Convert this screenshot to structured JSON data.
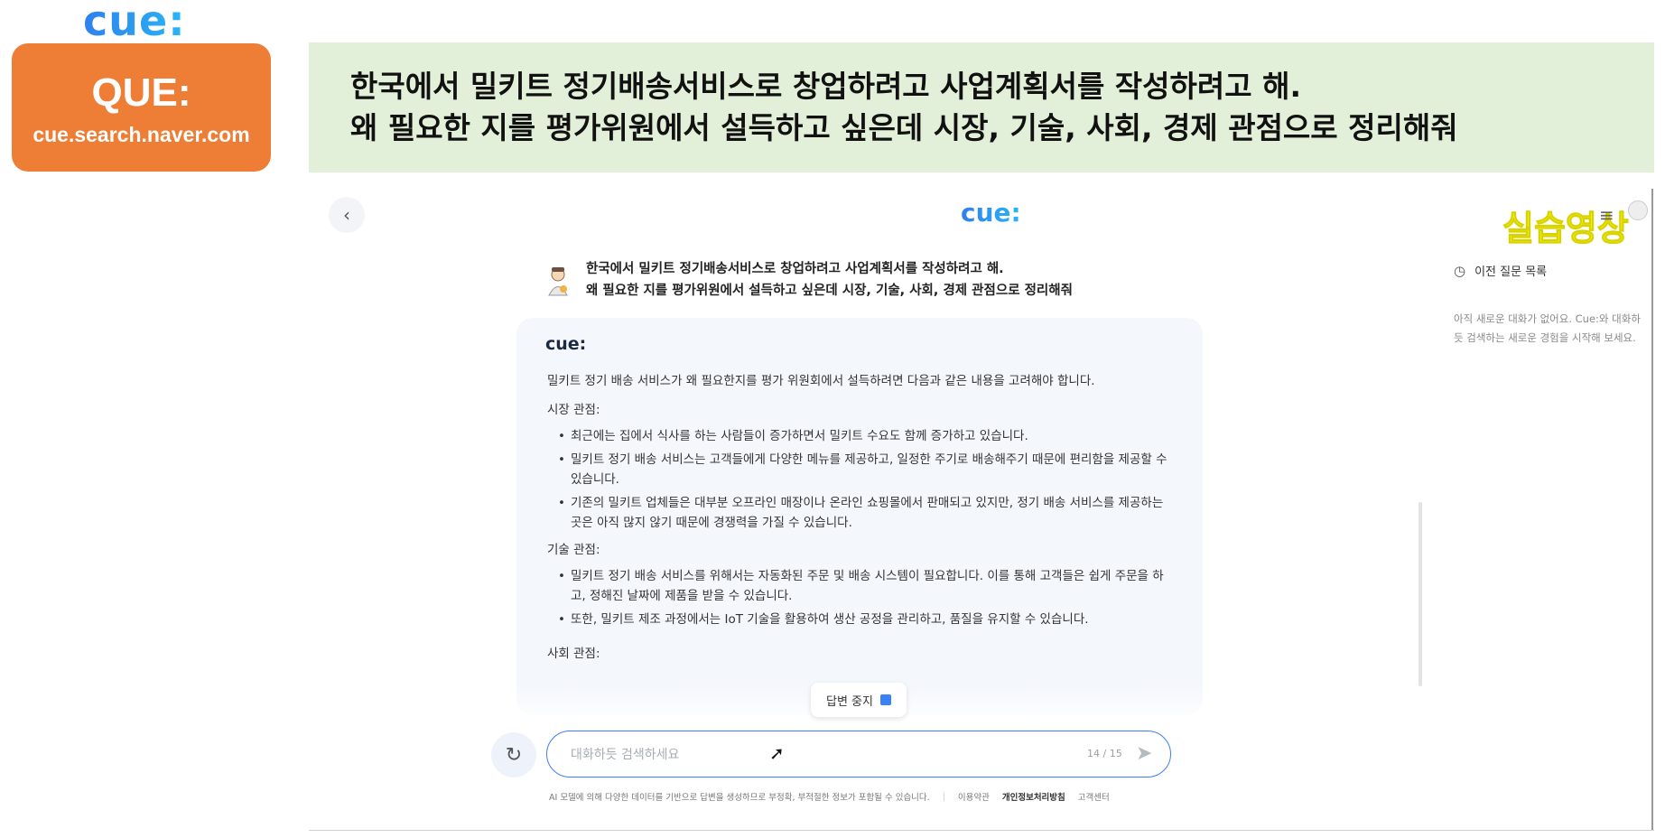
{
  "header": {
    "top_logo": "cue:",
    "badge_title": "QUE:",
    "badge_url": "cue.search.naver.com",
    "prompt_line1": "한국에서 밀키트 정기배송서비스로 창업하려고 사업계획서를 작성하려고 해.",
    "prompt_line2": "왜 필요한 지를 평가위원에서 설득하고 싶은데 시장, 기술, 사회, 경제 관점으로 정리해줘"
  },
  "app": {
    "logo": "cue:",
    "practice_label": "실습영상",
    "back_icon": "chevron-left-icon",
    "menu_icon": "hamburger-menu-icon"
  },
  "sidebar": {
    "history_label": "이전 질문 목록",
    "empty_text": "아직 새로운 대화가 없어요. Cue:와 대화하듯 검색하는 새로운 경험을 시작해 보세요."
  },
  "conversation": {
    "user_line1": "한국에서 밀키트 정기배송서비스로 창업하려고 사업계획서를 작성하려고 해.",
    "user_line2": "왜 필요한 지를 평가위원에서 설득하고 싶은데 시장, 기술, 사회, 경제 관점으로 정리해줘",
    "answer_logo": "cue:",
    "intro": "밀키트 정기 배송 서비스가 왜 필요한지를 평가 위원회에서 설득하려면 다음과 같은 내용을 고려해야 합니다.",
    "market_title": "시장 관점:",
    "market_items": [
      "최근에는 집에서 식사를 하는 사람들이 증가하면서 밀키트 수요도 함께 증가하고 있습니다.",
      "밀키트 정기 배송 서비스는 고객들에게 다양한 메뉴를 제공하고, 일정한 주기로 배송해주기 때문에 편리함을 제공할 수 있습니다.",
      "기존의 밀키트 업체들은 대부분 오프라인 매장이나 온라인 쇼핑몰에서 판매되고 있지만, 정기 배송 서비스를 제공하는 곳은 아직 많지 않기 때문에 경쟁력을 가질 수 있습니다."
    ],
    "tech_title": "기술 관점:",
    "tech_items": [
      "밀키트 정기 배송 서비스를 위해서는 자동화된 주문 및 배송 시스템이 필요합니다. 이를 통해 고객들은 쉽게 주문을 하고, 정해진 날짜에 제품을 받을 수 있습니다.",
      "또한, 밀키트 제조 과정에서는 IoT 기술을 활용하여 생산 공정을 관리하고, 품질을 유지할 수 있습니다."
    ],
    "social_title": "사회 관점:",
    "stop_label": "답변 중지"
  },
  "input": {
    "placeholder": "대화하듯 검색하세요",
    "char_count": "14 / 15"
  },
  "footer": {
    "disclaimer": "AI 모델에 의해 다양한 데이터를 기반으로 답변을 생성하므로 부정확, 부적절한 정보가 포함될 수 있습니다.",
    "terms": "이용약관",
    "privacy": "개인정보처리방침",
    "support": "고객센터"
  }
}
